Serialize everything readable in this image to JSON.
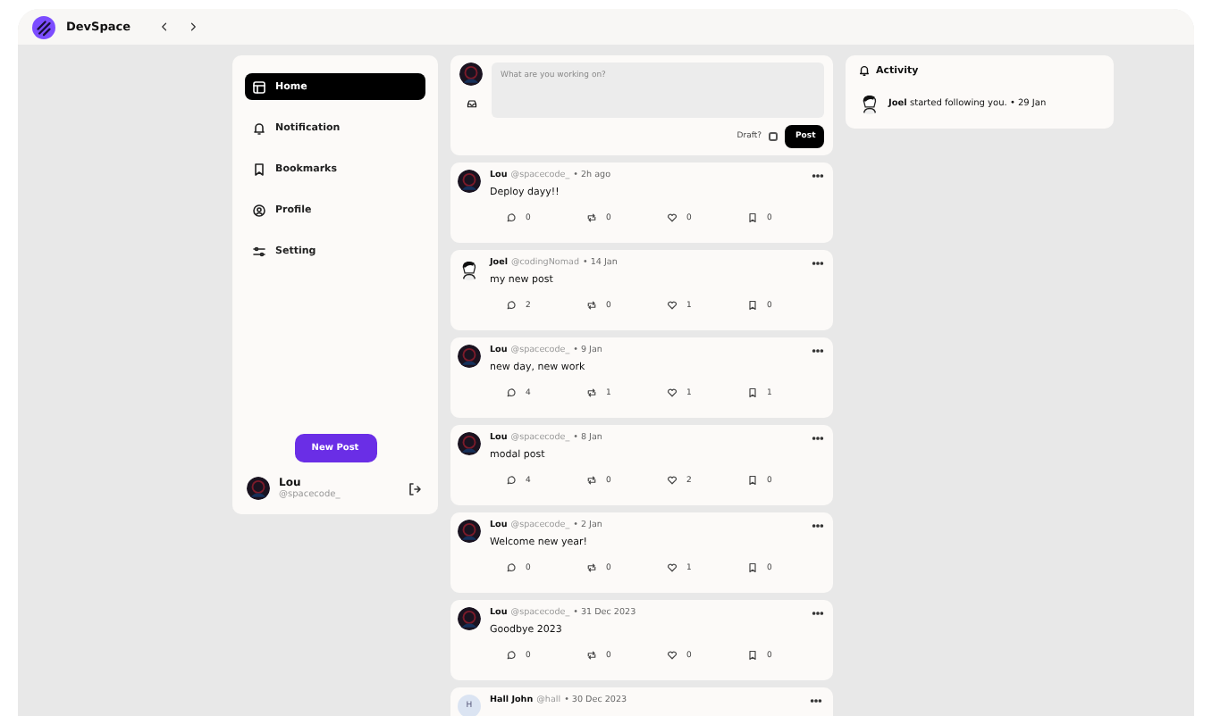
{
  "app": {
    "name": "DevSpace"
  },
  "sidebar": {
    "items": [
      {
        "label": "Home",
        "selected": true
      },
      {
        "label": "Notification",
        "selected": false
      },
      {
        "label": "Bookmarks",
        "selected": false
      },
      {
        "label": "Profile",
        "selected": false
      },
      {
        "label": "Setting",
        "selected": false
      }
    ],
    "new_post_button": "New Post",
    "user": {
      "name": "Lou",
      "handle": "@spacecode_"
    }
  },
  "composer": {
    "placeholder": "What are you working on?",
    "draft_label": "Draft?",
    "draft_checked": false,
    "post_button": "Post"
  },
  "posts": [
    {
      "kind": "photo",
      "name": "Lou",
      "handle": "@spacecode_",
      "time": "• 2h ago",
      "text": "Deploy dayy!!",
      "comments": "0",
      "reposts": "0",
      "likes": "0",
      "bookmarks": "0"
    },
    {
      "kind": "drawing",
      "name": "Joel",
      "handle": "@codingNomad",
      "time": "• 14 Jan",
      "text": "my new post",
      "comments": "2",
      "reposts": "0",
      "likes": "1",
      "bookmarks": "0"
    },
    {
      "kind": "photo",
      "name": "Lou",
      "handle": "@spacecode_",
      "time": "• 9 Jan",
      "text": "new day, new work",
      "comments": "4",
      "reposts": "1",
      "likes": "1",
      "bookmarks": "1"
    },
    {
      "kind": "photo",
      "name": "Lou",
      "handle": "@spacecode_",
      "time": "• 8 Jan",
      "text": "modal post",
      "comments": "4",
      "reposts": "0",
      "likes": "2",
      "bookmarks": "0"
    },
    {
      "kind": "photo",
      "name": "Lou",
      "handle": "@spacecode_",
      "time": "• 2 Jan",
      "text": "Welcome new year!",
      "comments": "0",
      "reposts": "0",
      "likes": "1",
      "bookmarks": "0"
    },
    {
      "kind": "photo",
      "name": "Lou",
      "handle": "@spacecode_",
      "time": "• 31 Dec 2023",
      "text": "Goodbye 2023",
      "comments": "0",
      "reposts": "0",
      "likes": "0",
      "bookmarks": "0"
    },
    {
      "kind": "initial",
      "avatar_letter": "H",
      "name": "Hall John",
      "handle": "@hall",
      "time": "• 30 Dec 2023"
    }
  ],
  "activity": {
    "title": "Activity",
    "items": [
      {
        "name": "Joel",
        "text": "started following you.",
        "time": "• 29 Jan"
      }
    ]
  }
}
